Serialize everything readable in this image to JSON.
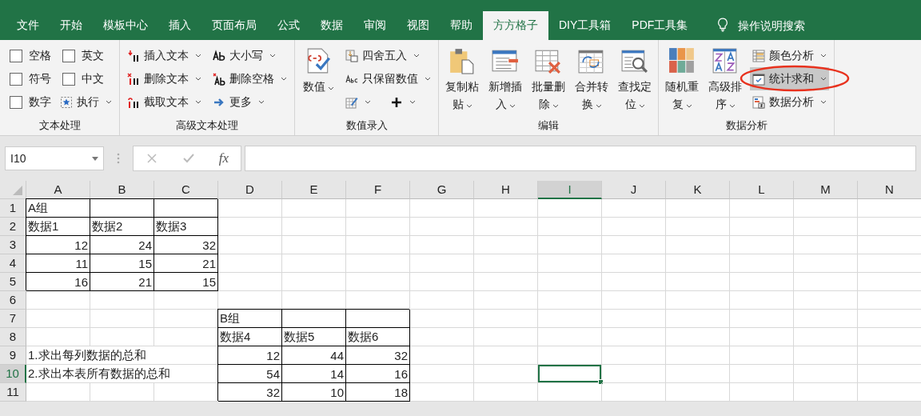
{
  "tabs": [
    {
      "label": "文件",
      "selected": false
    },
    {
      "label": "开始",
      "selected": false
    },
    {
      "label": "模板中心",
      "selected": false
    },
    {
      "label": "插入",
      "selected": false
    },
    {
      "label": "页面布局",
      "selected": false
    },
    {
      "label": "公式",
      "selected": false
    },
    {
      "label": "数据",
      "selected": false
    },
    {
      "label": "审阅",
      "selected": false
    },
    {
      "label": "视图",
      "selected": false
    },
    {
      "label": "帮助",
      "selected": false
    },
    {
      "label": "方方格子",
      "selected": true
    },
    {
      "label": "DIY工具箱",
      "selected": false
    },
    {
      "label": "PDF工具集",
      "selected": false
    }
  ],
  "tell_me": {
    "label": "操作说明搜索"
  },
  "ribbon": {
    "groups": [
      {
        "label": "文本处理",
        "columns": [
          {
            "kind": "stack",
            "items": [
              {
                "kind": "checkbox",
                "label": "空格",
                "checked": false
              },
              {
                "kind": "checkbox",
                "label": "符号",
                "checked": false
              },
              {
                "kind": "checkbox",
                "label": "数字",
                "checked": false
              }
            ]
          },
          {
            "kind": "stack",
            "items": [
              {
                "kind": "checkbox",
                "label": "英文",
                "checked": false
              },
              {
                "kind": "checkbox",
                "label": "中文",
                "checked": false
              },
              {
                "kind": "small",
                "label": "执行",
                "dropdown": true
              }
            ]
          }
        ]
      },
      {
        "label": "高级文本处理",
        "columns": [
          {
            "kind": "stack",
            "items": [
              {
                "kind": "small",
                "label": "插入文本",
                "dropdown": true
              },
              {
                "kind": "small",
                "label": "删除文本",
                "dropdown": true
              },
              {
                "kind": "small",
                "label": "截取文本",
                "dropdown": true
              }
            ]
          },
          {
            "kind": "stack",
            "items": [
              {
                "kind": "small",
                "label": "大小写",
                "dropdown": true
              },
              {
                "kind": "small",
                "label": "删除空格",
                "dropdown": true
              },
              {
                "kind": "small",
                "label": "更多",
                "dropdown": true
              }
            ]
          }
        ]
      },
      {
        "label": "数值录入",
        "columns": [
          {
            "kind": "large",
            "items": [
              {
                "label": "数值",
                "dropdown": true
              }
            ]
          },
          {
            "kind": "stack",
            "items": [
              {
                "kind": "small",
                "label": "四舍五入",
                "dropdown": true
              },
              {
                "kind": "small",
                "label": "只保留数值",
                "dropdown": true
              },
              {
                "kind": "icons",
                "buttons": [
                  {
                    "dropdown": true
                  },
                  {
                    "dropdown": true
                  }
                ]
              }
            ]
          }
        ]
      },
      {
        "label": "编辑",
        "columns": [
          {
            "kind": "large",
            "items": [
              {
                "label": "复制粘贴",
                "dropdown": true
              }
            ]
          },
          {
            "kind": "large",
            "items": [
              {
                "label": "新增插入",
                "dropdown": true
              }
            ]
          },
          {
            "kind": "large",
            "items": [
              {
                "label": "批量删除",
                "dropdown": true
              }
            ]
          },
          {
            "kind": "large",
            "items": [
              {
                "label": "合并转换",
                "dropdown": true
              }
            ]
          },
          {
            "kind": "large",
            "items": [
              {
                "label": "查找定位",
                "dropdown": true
              }
            ]
          }
        ]
      },
      {
        "label": "数据分析",
        "columns": [
          {
            "kind": "large",
            "items": [
              {
                "label": "随机重复",
                "dropdown": true
              }
            ]
          },
          {
            "kind": "large",
            "items": [
              {
                "label": "高级排序",
                "dropdown": true
              }
            ]
          },
          {
            "kind": "stack",
            "items": [
              {
                "kind": "small",
                "label": "颜色分析",
                "dropdown": true,
                "highlighted": false,
                "circled": false
              },
              {
                "kind": "small",
                "label": "统计求和",
                "dropdown": true,
                "highlighted": true,
                "circled": true
              },
              {
                "kind": "small",
                "label": "数据分析",
                "dropdown": true,
                "highlighted": false,
                "circled": false
              }
            ]
          }
        ]
      }
    ]
  },
  "formula_bar": {
    "name_box": "I10",
    "function_label": "fx"
  },
  "columns": [
    {
      "label": "A",
      "selected": false
    },
    {
      "label": "B",
      "selected": false
    },
    {
      "label": "C",
      "selected": false
    },
    {
      "label": "D",
      "selected": false
    },
    {
      "label": "E",
      "selected": false
    },
    {
      "label": "F",
      "selected": false
    },
    {
      "label": "G",
      "selected": false
    },
    {
      "label": "H",
      "selected": false
    },
    {
      "label": "I",
      "selected": true
    },
    {
      "label": "J",
      "selected": false
    },
    {
      "label": "K",
      "selected": false
    },
    {
      "label": "L",
      "selected": false
    },
    {
      "label": "M",
      "selected": false
    },
    {
      "label": "N",
      "selected": false
    }
  ],
  "rows": [
    {
      "label": "1",
      "selected": false,
      "cells": {
        "A": {
          "text": "A组",
          "kind": "text",
          "boxed": true
        },
        "B": {
          "boxed": true
        },
        "C": {
          "boxed": true
        }
      }
    },
    {
      "label": "2",
      "selected": false,
      "cells": {
        "A": {
          "text": "数据1",
          "kind": "text",
          "boxed": true
        },
        "B": {
          "text": "数据2",
          "kind": "text",
          "boxed": true
        },
        "C": {
          "text": "数据3",
          "kind": "text",
          "boxed": true
        }
      }
    },
    {
      "label": "3",
      "selected": false,
      "cells": {
        "A": {
          "text": "12",
          "kind": "number",
          "boxed": true
        },
        "B": {
          "text": "24",
          "kind": "number",
          "boxed": true
        },
        "C": {
          "text": "32",
          "kind": "number",
          "boxed": true
        }
      }
    },
    {
      "label": "4",
      "selected": false,
      "cells": {
        "A": {
          "text": "11",
          "kind": "number",
          "boxed": true
        },
        "B": {
          "text": "15",
          "kind": "number",
          "boxed": true
        },
        "C": {
          "text": "21",
          "kind": "number",
          "boxed": true
        }
      }
    },
    {
      "label": "5",
      "selected": false,
      "cells": {
        "A": {
          "text": "16",
          "kind": "number",
          "boxed": true
        },
        "B": {
          "text": "21",
          "kind": "number",
          "boxed": true
        },
        "C": {
          "text": "15",
          "kind": "number",
          "boxed": true
        }
      }
    },
    {
      "label": "6",
      "selected": false,
      "cells": {}
    },
    {
      "label": "7",
      "selected": false,
      "cells": {
        "D": {
          "text": "B组",
          "kind": "text",
          "boxed": true
        },
        "E": {
          "boxed": true
        },
        "F": {
          "boxed": true
        }
      }
    },
    {
      "label": "8",
      "selected": false,
      "cells": {
        "D": {
          "text": "数据4",
          "kind": "text",
          "boxed": true
        },
        "E": {
          "text": "数据5",
          "kind": "text",
          "boxed": true
        },
        "F": {
          "text": "数据6",
          "kind": "text",
          "boxed": true
        }
      }
    },
    {
      "label": "9",
      "selected": false,
      "cells": {
        "A": {
          "text": "1.求出每列数据的总和",
          "kind": "text",
          "boxed": false
        },
        "D": {
          "text": "12",
          "kind": "number",
          "boxed": true
        },
        "E": {
          "text": "44",
          "kind": "number",
          "boxed": true
        },
        "F": {
          "text": "32",
          "kind": "number",
          "boxed": true
        }
      }
    },
    {
      "label": "10",
      "selected": true,
      "cells": {
        "A": {
          "text": "2.求出本表所有数据的总和",
          "kind": "text",
          "boxed": false
        },
        "D": {
          "text": "54",
          "kind": "number",
          "boxed": true
        },
        "E": {
          "text": "14",
          "kind": "number",
          "boxed": true
        },
        "F": {
          "text": "16",
          "kind": "number",
          "boxed": true
        },
        "I": {
          "boxed": false,
          "active": true
        }
      }
    },
    {
      "label": "11",
      "selected": false,
      "cells": {
        "D": {
          "text": "32",
          "kind": "number",
          "boxed": true
        },
        "E": {
          "text": "10",
          "kind": "number",
          "boxed": true
        },
        "F": {
          "text": "18",
          "kind": "number",
          "boxed": true
        }
      }
    }
  ]
}
